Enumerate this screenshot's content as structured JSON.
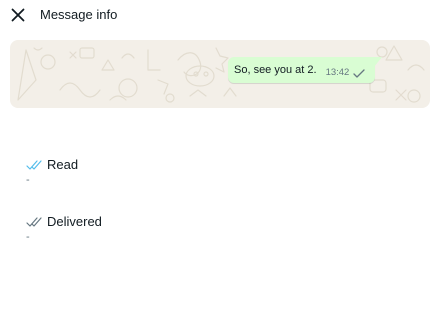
{
  "header": {
    "title": "Message info",
    "close_icon": "close-icon"
  },
  "message": {
    "text": "So, see you at 2.",
    "time": "13:42",
    "status_icon": "single-check-icon"
  },
  "colors": {
    "bubble": "#d9fdd3",
    "chat_background": "#f3efe8",
    "read_tick": "#53bdeb",
    "delivered_tick": "#667781"
  },
  "receipts": [
    {
      "label": "Read",
      "time": "-",
      "icon": "double-check-read-icon"
    },
    {
      "label": "Delivered",
      "time": "-",
      "icon": "double-check-delivered-icon"
    }
  ]
}
